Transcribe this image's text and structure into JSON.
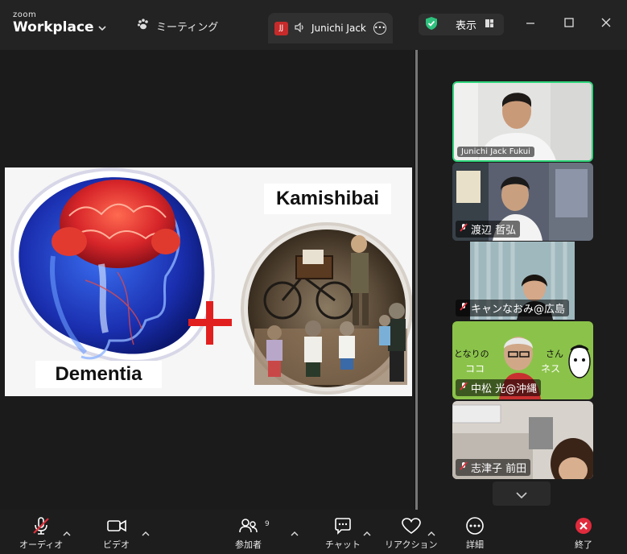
{
  "app": {
    "logo_small": "zoom",
    "logo_big": "Workplace"
  },
  "tabs": {
    "meeting_label": "ミーティング",
    "speaker_badge": "JJ",
    "speaker_name": "Junichi Jack"
  },
  "view": {
    "label": "表示"
  },
  "slide": {
    "label_kamishibai": "Kamishibai",
    "label_dementia": "Dementia"
  },
  "participants": [
    {
      "name": "Junichi Jack Fukui",
      "active": true,
      "muted": false
    },
    {
      "name": "渡辺 哲弘",
      "active": false,
      "muted": true
    },
    {
      "name": "キャンなおみ@広島",
      "active": false,
      "muted": true
    },
    {
      "name": "中松 光@沖縄",
      "active": false,
      "muted": true,
      "bg_text_1": "となりの",
      "bg_text_2": "さん",
      "bg_text_3": "ココ",
      "bg_text_4": "ネス"
    },
    {
      "name": "志津子 前田",
      "active": false,
      "muted": true
    }
  ],
  "toolbar": {
    "audio": "オーディオ",
    "video": "ビデオ",
    "participants": "参加者",
    "participants_count": "9",
    "chat": "チャット",
    "reaction": "リアクション",
    "details": "詳細",
    "end": "終了"
  },
  "colors": {
    "active_border": "#2ed47a",
    "end_red": "#e02b3c",
    "mute_red": "#e0303c"
  }
}
